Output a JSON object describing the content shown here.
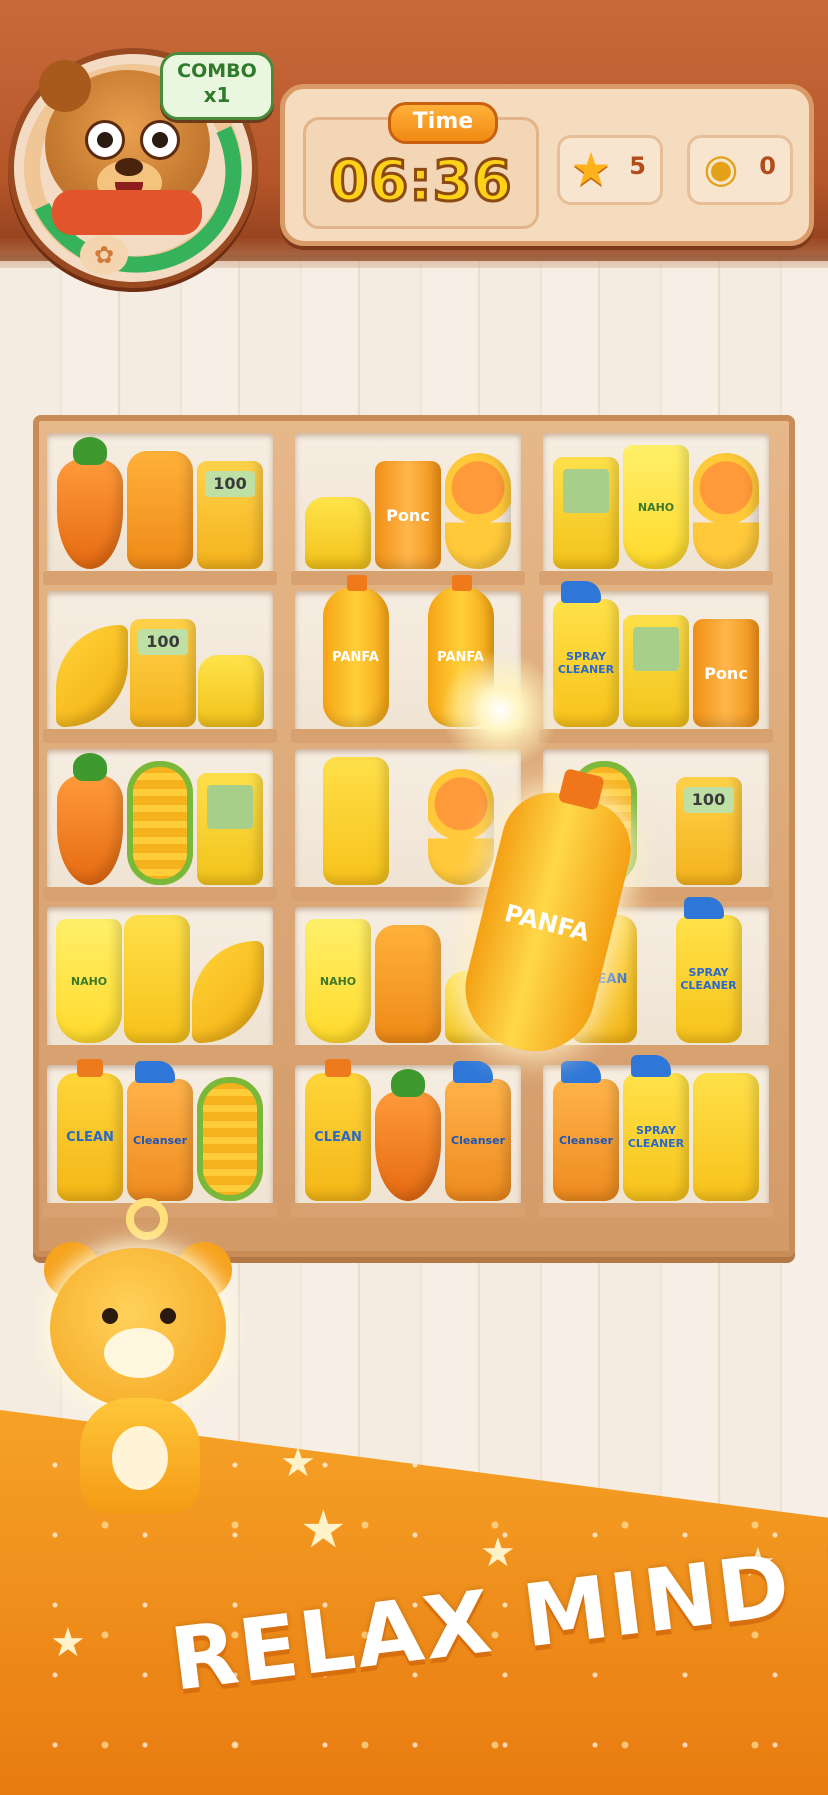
{
  "hud": {
    "combo_label": "COMBO",
    "combo_value": "x1",
    "time_label": "Time",
    "time_value": "06:36",
    "stars_icon": "star-icon",
    "stars_count": "5",
    "honey_icon": "honey-pot-icon",
    "honey_count": "0"
  },
  "shelf": {
    "cells": [
      {
        "items": [
          {
            "type": "carrot",
            "label": ""
          },
          {
            "type": "lotion",
            "label": ""
          },
          {
            "type": "calc",
            "label": "100"
          }
        ]
      },
      {
        "items": [
          {
            "type": "car",
            "label": ""
          },
          {
            "type": "can",
            "label": "Ponc"
          },
          {
            "type": "fan",
            "label": ""
          }
        ]
      },
      {
        "items": [
          {
            "type": "game",
            "label": ""
          },
          {
            "type": "cream",
            "label": "NAHO"
          },
          {
            "type": "fan",
            "label": ""
          }
        ]
      },
      {
        "items": [
          {
            "type": "banana",
            "label": ""
          },
          {
            "type": "calc",
            "label": "100"
          },
          {
            "type": "car",
            "label": ""
          }
        ]
      },
      {
        "items": [
          {
            "type": "bottle",
            "label": "PANFA"
          },
          {
            "type": "bottle",
            "label": "PANFA"
          }
        ]
      },
      {
        "items": [
          {
            "type": "spray",
            "label": "SPRAY CLEANER"
          },
          {
            "type": "game",
            "label": ""
          },
          {
            "type": "can",
            "label": "Ponc"
          }
        ]
      },
      {
        "items": [
          {
            "type": "carrot",
            "label": ""
          },
          {
            "type": "corn",
            "label": ""
          },
          {
            "type": "game",
            "label": ""
          }
        ]
      },
      {
        "items": [
          {
            "type": "soap",
            "label": ""
          },
          {
            "type": "fan",
            "label": ""
          }
        ]
      },
      {
        "items": [
          {
            "type": "corn",
            "label": ""
          },
          {
            "type": "calc",
            "label": "100"
          }
        ]
      },
      {
        "items": [
          {
            "type": "cream",
            "label": "NAHO"
          },
          {
            "type": "soap",
            "label": ""
          },
          {
            "type": "banana",
            "label": ""
          }
        ]
      },
      {
        "items": [
          {
            "type": "cream",
            "label": "NAHO"
          },
          {
            "type": "lotion",
            "label": ""
          },
          {
            "type": "car",
            "label": ""
          }
        ]
      },
      {
        "items": [
          {
            "type": "jug",
            "label": "CLEAN"
          },
          {
            "type": "spray",
            "label": "SPRAY CLEANER"
          }
        ]
      },
      {
        "items": [
          {
            "type": "jug",
            "label": "CLEAN"
          },
          {
            "type": "cleanser",
            "label": "Cleanser"
          },
          {
            "type": "corn",
            "label": ""
          }
        ]
      },
      {
        "items": [
          {
            "type": "jug",
            "label": "CLEAN"
          },
          {
            "type": "carrot",
            "label": ""
          },
          {
            "type": "cleanser",
            "label": "Cleanser"
          }
        ]
      },
      {
        "items": [
          {
            "type": "cleanser",
            "label": "Cleanser"
          },
          {
            "type": "spray",
            "label": "SPRAY CLEANER"
          },
          {
            "type": "soap",
            "label": ""
          }
        ]
      }
    ],
    "held_item_label": "PANFA"
  },
  "banner": {
    "tagline": "RELAX MIND !"
  },
  "colors": {
    "accent": "#f08a12",
    "topbar": "#b5562a",
    "time_text": "#ffd21a"
  }
}
